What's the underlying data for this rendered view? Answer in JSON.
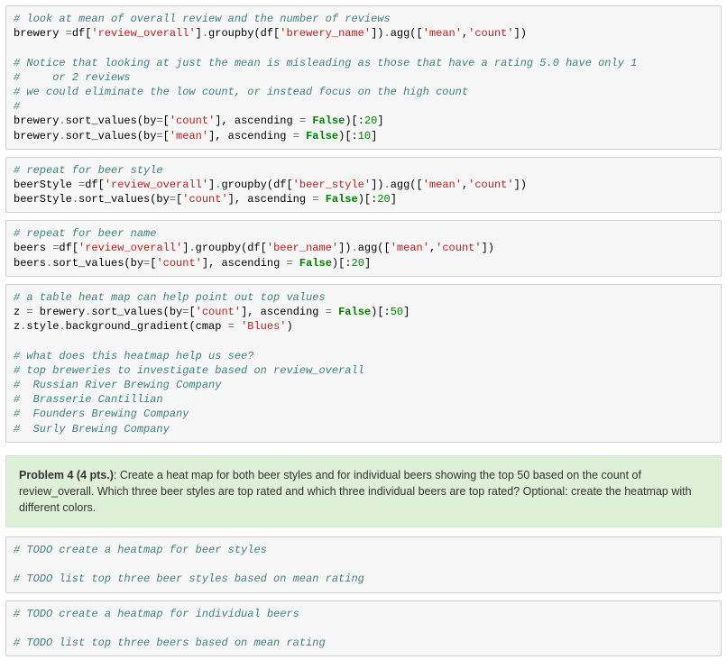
{
  "cells": [
    {
      "type": "code",
      "tokens": [
        {
          "cls": "c-comment",
          "t": "# look at mean of overall review and the number of reviews"
        },
        {
          "cls": "nl"
        },
        {
          "cls": "c-plain",
          "t": "brewery "
        },
        {
          "cls": "c-op",
          "t": "="
        },
        {
          "cls": "c-plain",
          "t": "df["
        },
        {
          "cls": "c-string",
          "t": "'review_overall'"
        },
        {
          "cls": "c-plain",
          "t": "]"
        },
        {
          "cls": "c-op",
          "t": "."
        },
        {
          "cls": "c-plain",
          "t": "groupby(df["
        },
        {
          "cls": "c-string",
          "t": "'brewery_name'"
        },
        {
          "cls": "c-plain",
          "t": "])"
        },
        {
          "cls": "c-op",
          "t": "."
        },
        {
          "cls": "c-plain",
          "t": "agg(["
        },
        {
          "cls": "c-string",
          "t": "'mean'"
        },
        {
          "cls": "c-plain",
          "t": ","
        },
        {
          "cls": "c-string",
          "t": "'count'"
        },
        {
          "cls": "c-plain",
          "t": "])"
        },
        {
          "cls": "nl"
        },
        {
          "cls": "nl"
        },
        {
          "cls": "c-comment",
          "t": "# Notice that looking at just the mean is misleading as those that have a rating 5.0 have only 1"
        },
        {
          "cls": "nl"
        },
        {
          "cls": "c-comment",
          "t": "#     or 2 reviews"
        },
        {
          "cls": "nl"
        },
        {
          "cls": "c-comment",
          "t": "# we could eliminate the low count, or instead focus on the high count"
        },
        {
          "cls": "nl"
        },
        {
          "cls": "c-comment",
          "t": "#"
        },
        {
          "cls": "nl"
        },
        {
          "cls": "c-plain",
          "t": "brewery"
        },
        {
          "cls": "c-op",
          "t": "."
        },
        {
          "cls": "c-plain",
          "t": "sort_values(by"
        },
        {
          "cls": "c-op",
          "t": "="
        },
        {
          "cls": "c-plain",
          "t": "["
        },
        {
          "cls": "c-string",
          "t": "'count'"
        },
        {
          "cls": "c-plain",
          "t": "], ascending "
        },
        {
          "cls": "c-op",
          "t": "="
        },
        {
          "cls": "c-plain",
          "t": " "
        },
        {
          "cls": "c-kw",
          "t": "False"
        },
        {
          "cls": "c-plain",
          "t": ")[:"
        },
        {
          "cls": "c-num",
          "t": "20"
        },
        {
          "cls": "c-plain",
          "t": "]"
        },
        {
          "cls": "nl"
        },
        {
          "cls": "c-plain",
          "t": "brewery"
        },
        {
          "cls": "c-op",
          "t": "."
        },
        {
          "cls": "c-plain",
          "t": "sort_values(by"
        },
        {
          "cls": "c-op",
          "t": "="
        },
        {
          "cls": "c-plain",
          "t": "["
        },
        {
          "cls": "c-string",
          "t": "'mean'"
        },
        {
          "cls": "c-plain",
          "t": "], ascending "
        },
        {
          "cls": "c-op",
          "t": "="
        },
        {
          "cls": "c-plain",
          "t": " "
        },
        {
          "cls": "c-kw",
          "t": "False"
        },
        {
          "cls": "c-plain",
          "t": ")[:"
        },
        {
          "cls": "c-num",
          "t": "10"
        },
        {
          "cls": "c-plain",
          "t": "]"
        }
      ]
    },
    {
      "type": "code",
      "tokens": [
        {
          "cls": "c-comment",
          "t": "# repeat for beer style"
        },
        {
          "cls": "nl"
        },
        {
          "cls": "c-plain",
          "t": "beerStyle "
        },
        {
          "cls": "c-op",
          "t": "="
        },
        {
          "cls": "c-plain",
          "t": "df["
        },
        {
          "cls": "c-string",
          "t": "'review_overall'"
        },
        {
          "cls": "c-plain",
          "t": "]"
        },
        {
          "cls": "c-op",
          "t": "."
        },
        {
          "cls": "c-plain",
          "t": "groupby(df["
        },
        {
          "cls": "c-string",
          "t": "'beer_style'"
        },
        {
          "cls": "c-plain",
          "t": "])"
        },
        {
          "cls": "c-op",
          "t": "."
        },
        {
          "cls": "c-plain",
          "t": "agg(["
        },
        {
          "cls": "c-string",
          "t": "'mean'"
        },
        {
          "cls": "c-plain",
          "t": ","
        },
        {
          "cls": "c-string",
          "t": "'count'"
        },
        {
          "cls": "c-plain",
          "t": "])"
        },
        {
          "cls": "nl"
        },
        {
          "cls": "c-plain",
          "t": "beerStyle"
        },
        {
          "cls": "c-op",
          "t": "."
        },
        {
          "cls": "c-plain",
          "t": "sort_values(by"
        },
        {
          "cls": "c-op",
          "t": "="
        },
        {
          "cls": "c-plain",
          "t": "["
        },
        {
          "cls": "c-string",
          "t": "'count'"
        },
        {
          "cls": "c-plain",
          "t": "], ascending "
        },
        {
          "cls": "c-op",
          "t": "="
        },
        {
          "cls": "c-plain",
          "t": " "
        },
        {
          "cls": "c-kw",
          "t": "False"
        },
        {
          "cls": "c-plain",
          "t": ")[:"
        },
        {
          "cls": "c-num",
          "t": "20"
        },
        {
          "cls": "c-plain",
          "t": "]"
        }
      ]
    },
    {
      "type": "code",
      "tokens": [
        {
          "cls": "c-comment",
          "t": "# repeat for beer name"
        },
        {
          "cls": "nl"
        },
        {
          "cls": "c-plain",
          "t": "beers "
        },
        {
          "cls": "c-op",
          "t": "="
        },
        {
          "cls": "c-plain",
          "t": "df["
        },
        {
          "cls": "c-string",
          "t": "'review_overall'"
        },
        {
          "cls": "c-plain",
          "t": "]"
        },
        {
          "cls": "c-op",
          "t": "."
        },
        {
          "cls": "c-plain",
          "t": "groupby(df["
        },
        {
          "cls": "c-string",
          "t": "'beer_name'"
        },
        {
          "cls": "c-plain",
          "t": "])"
        },
        {
          "cls": "c-op",
          "t": "."
        },
        {
          "cls": "c-plain",
          "t": "agg(["
        },
        {
          "cls": "c-string",
          "t": "'mean'"
        },
        {
          "cls": "c-plain",
          "t": ","
        },
        {
          "cls": "c-string",
          "t": "'count'"
        },
        {
          "cls": "c-plain",
          "t": "])"
        },
        {
          "cls": "nl"
        },
        {
          "cls": "c-plain",
          "t": "beers"
        },
        {
          "cls": "c-op",
          "t": "."
        },
        {
          "cls": "c-plain",
          "t": "sort_values(by"
        },
        {
          "cls": "c-op",
          "t": "="
        },
        {
          "cls": "c-plain",
          "t": "["
        },
        {
          "cls": "c-string",
          "t": "'count'"
        },
        {
          "cls": "c-plain",
          "t": "], ascending "
        },
        {
          "cls": "c-op",
          "t": "="
        },
        {
          "cls": "c-plain",
          "t": " "
        },
        {
          "cls": "c-kw",
          "t": "False"
        },
        {
          "cls": "c-plain",
          "t": ")[:"
        },
        {
          "cls": "c-num",
          "t": "20"
        },
        {
          "cls": "c-plain",
          "t": "]"
        }
      ]
    },
    {
      "type": "code",
      "tokens": [
        {
          "cls": "c-comment",
          "t": "# a table heat map can help point out top values"
        },
        {
          "cls": "nl"
        },
        {
          "cls": "c-plain",
          "t": "z "
        },
        {
          "cls": "c-op",
          "t": "="
        },
        {
          "cls": "c-plain",
          "t": " brewery"
        },
        {
          "cls": "c-op",
          "t": "."
        },
        {
          "cls": "c-plain",
          "t": "sort_values(by"
        },
        {
          "cls": "c-op",
          "t": "="
        },
        {
          "cls": "c-plain",
          "t": "["
        },
        {
          "cls": "c-string",
          "t": "'count'"
        },
        {
          "cls": "c-plain",
          "t": "], ascending "
        },
        {
          "cls": "c-op",
          "t": "="
        },
        {
          "cls": "c-plain",
          "t": " "
        },
        {
          "cls": "c-kw",
          "t": "False"
        },
        {
          "cls": "c-plain",
          "t": ")[:"
        },
        {
          "cls": "c-num",
          "t": "50"
        },
        {
          "cls": "c-plain",
          "t": "]"
        },
        {
          "cls": "nl"
        },
        {
          "cls": "c-plain",
          "t": "z"
        },
        {
          "cls": "c-op",
          "t": "."
        },
        {
          "cls": "c-plain",
          "t": "style"
        },
        {
          "cls": "c-op",
          "t": "."
        },
        {
          "cls": "c-plain",
          "t": "background_gradient(cmap "
        },
        {
          "cls": "c-op",
          "t": "="
        },
        {
          "cls": "c-plain",
          "t": " "
        },
        {
          "cls": "c-string",
          "t": "'Blues'"
        },
        {
          "cls": "c-plain",
          "t": ")"
        },
        {
          "cls": "nl"
        },
        {
          "cls": "nl"
        },
        {
          "cls": "c-comment",
          "t": "# what does this heatmap help us see?"
        },
        {
          "cls": "nl"
        },
        {
          "cls": "c-comment",
          "t": "# top breweries to investigate based on review_overall"
        },
        {
          "cls": "nl"
        },
        {
          "cls": "c-comment",
          "t": "#  Russian River Brewing Company"
        },
        {
          "cls": "nl"
        },
        {
          "cls": "c-comment",
          "t": "#  Brasserie Cantillian"
        },
        {
          "cls": "nl"
        },
        {
          "cls": "c-comment",
          "t": "#  Founders Brewing Company"
        },
        {
          "cls": "nl"
        },
        {
          "cls": "c-comment",
          "t": "#  Surly Brewing Company"
        }
      ]
    },
    {
      "type": "problem",
      "title": "Problem 4 (4 pts.)",
      "body": ": Create a heat map for both beer styles and for individual beers showing the top 50 based on the count of review_overall. Which three beer styles are top rated and which three individual beers are top rated? Optional: create the heatmap with different colors."
    },
    {
      "type": "code",
      "tokens": [
        {
          "cls": "c-comment",
          "t": "# TODO create a heatmap for beer styles"
        },
        {
          "cls": "nl"
        },
        {
          "cls": "nl"
        },
        {
          "cls": "c-comment",
          "t": "# TODO list top three beer styles based on mean rating"
        }
      ]
    },
    {
      "type": "code",
      "tokens": [
        {
          "cls": "c-comment",
          "t": "# TODO create a heatmap for individual beers"
        },
        {
          "cls": "nl"
        },
        {
          "cls": "nl"
        },
        {
          "cls": "c-comment",
          "t": "# TODO list top three beers based on mean rating"
        }
      ]
    }
  ]
}
